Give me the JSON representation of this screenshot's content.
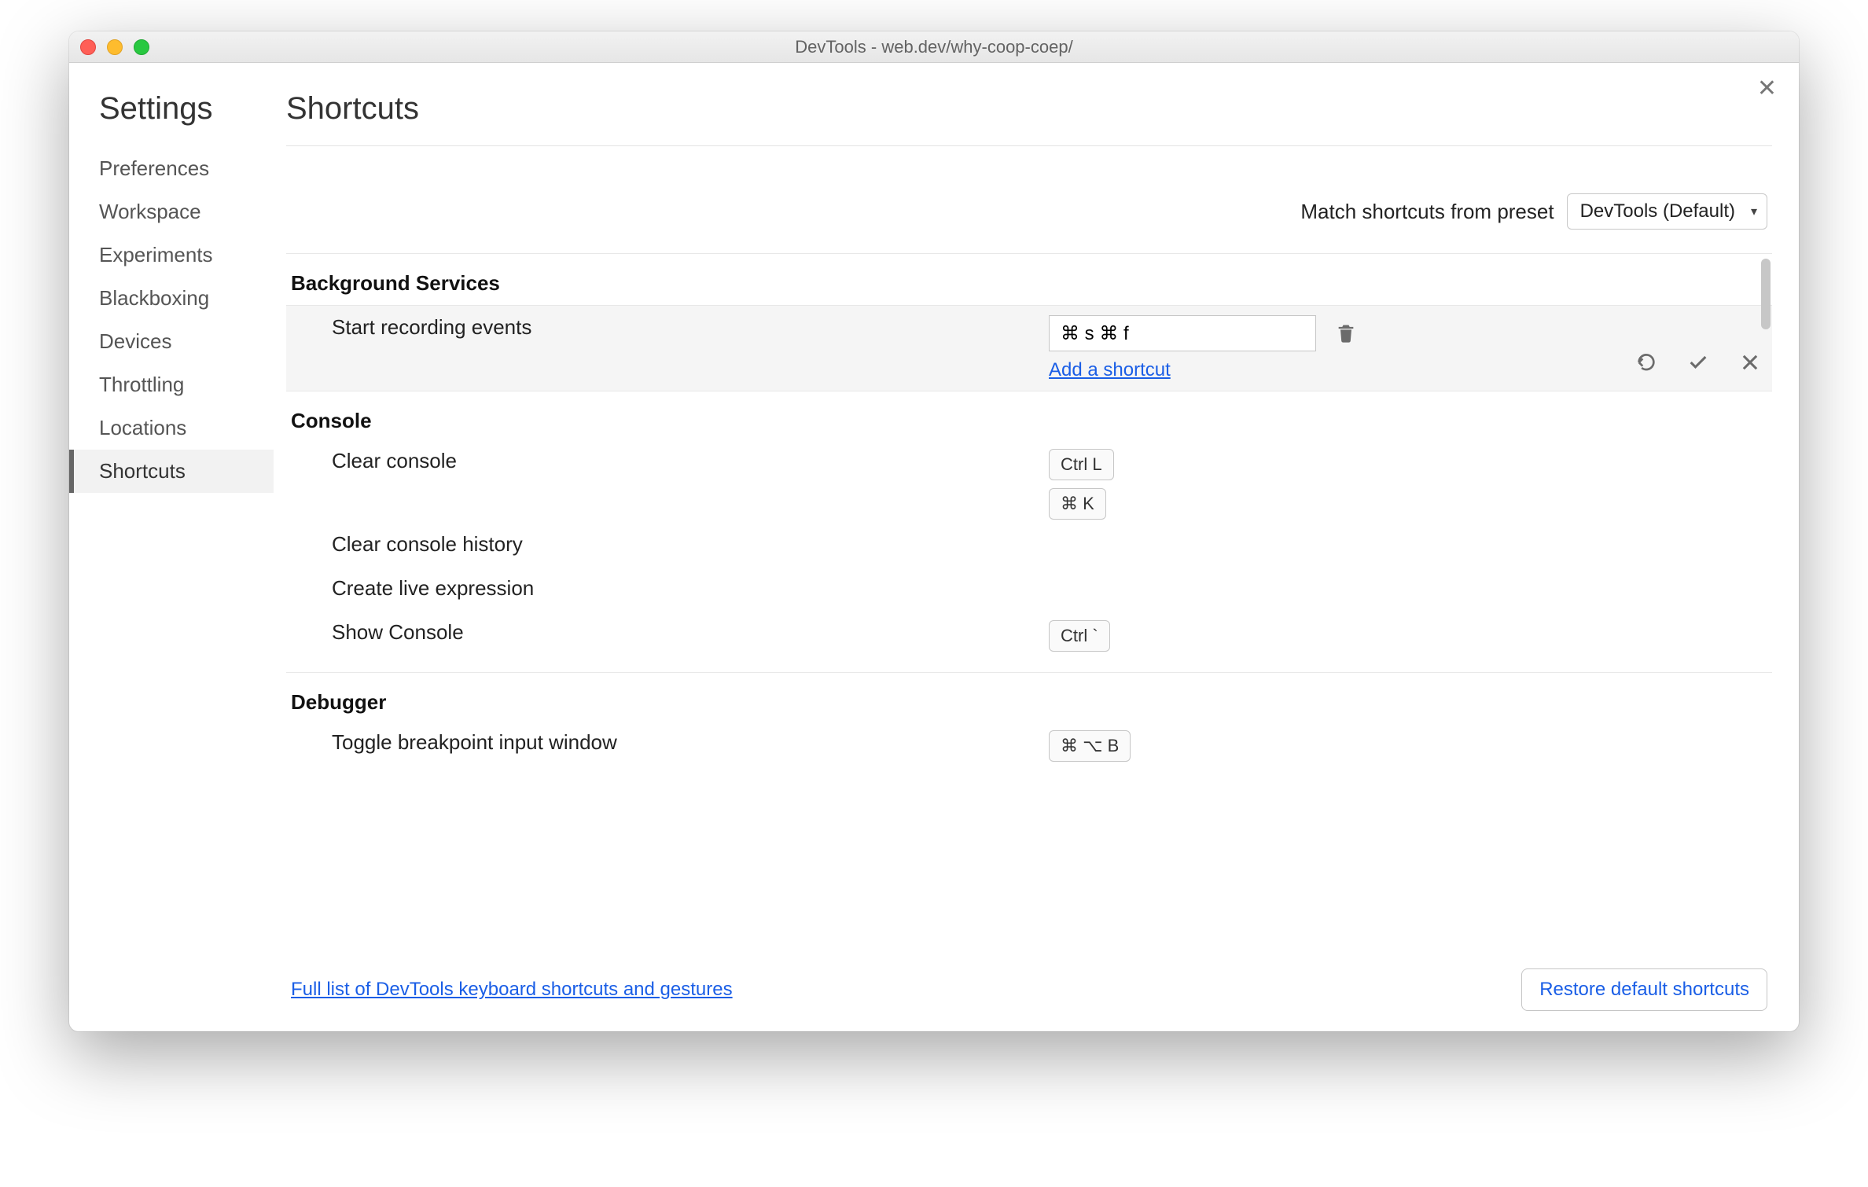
{
  "window_title": "DevTools - web.dev/why-coop-coep/",
  "sidebar": {
    "title": "Settings",
    "items": [
      {
        "label": "Preferences"
      },
      {
        "label": "Workspace"
      },
      {
        "label": "Experiments"
      },
      {
        "label": "Blackboxing"
      },
      {
        "label": "Devices"
      },
      {
        "label": "Throttling"
      },
      {
        "label": "Locations"
      },
      {
        "label": "Shortcuts",
        "selected": true
      }
    ]
  },
  "main": {
    "title": "Shortcuts",
    "preset_label": "Match shortcuts from preset",
    "preset_value": "DevTools (Default)"
  },
  "sections": {
    "background_services": {
      "title": "Background Services",
      "start_recording": {
        "label": "Start recording events",
        "chord_value": "⌘ s ⌘ f",
        "add_link": "Add a shortcut"
      }
    },
    "console": {
      "title": "Console",
      "clear_console": {
        "label": "Clear console",
        "keys": [
          "Ctrl L",
          "⌘ K"
        ]
      },
      "clear_history": {
        "label": "Clear console history"
      },
      "create_expr": {
        "label": "Create live expression"
      },
      "show_console": {
        "label": "Show Console",
        "keys": [
          "Ctrl `"
        ]
      }
    },
    "debugger": {
      "title": "Debugger",
      "toggle_bp": {
        "label": "Toggle breakpoint input window",
        "keys": [
          "⌘ ⌥ B"
        ]
      }
    }
  },
  "footer": {
    "link": "Full list of DevTools keyboard shortcuts and gestures",
    "restore": "Restore default shortcuts"
  }
}
